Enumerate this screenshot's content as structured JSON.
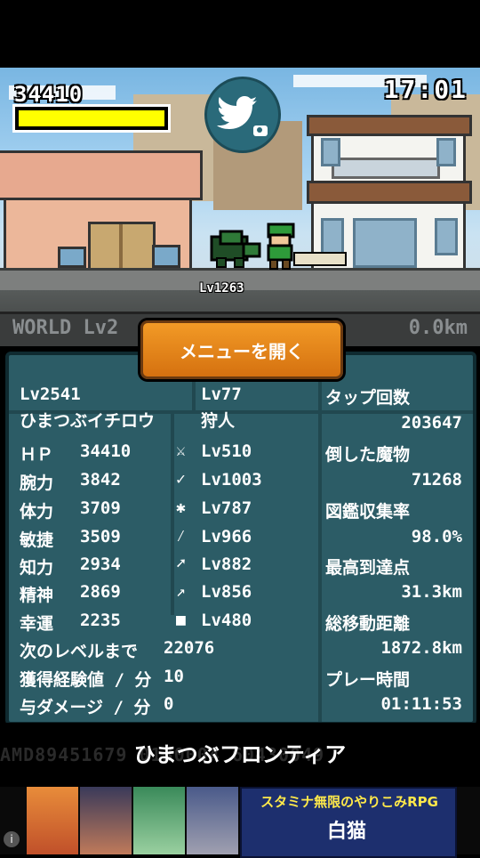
{
  "hud": {
    "score": "34410",
    "hp_fraction": 1.0,
    "clock": "17:01",
    "player_level_tag": "Lv1263",
    "world_label": "WORLD Lv2",
    "distance_label": "0.0km"
  },
  "menu": {
    "open_label": "メニューを開く"
  },
  "stats": {
    "player_level": "Lv2541",
    "player_name": "ひまつぶイチロウ",
    "job_level": "Lv77",
    "job_name": "狩人",
    "attributes": [
      {
        "label": "ＨＰ",
        "value": "34410",
        "skill_icon": "sword-icon",
        "skill": "Lv510"
      },
      {
        "label": "腕力",
        "value": "3842",
        "skill_icon": "dagger-icon",
        "skill": "Lv1003"
      },
      {
        "label": "体力",
        "value": "3709",
        "skill_icon": "axe-icon",
        "skill": "Lv787"
      },
      {
        "label": "敏捷",
        "value": "3509",
        "skill_icon": "spear-icon",
        "skill": "Lv966"
      },
      {
        "label": "知力",
        "value": "2934",
        "skill_icon": "bow-icon",
        "skill": "Lv882"
      },
      {
        "label": "精神",
        "value": "2869",
        "skill_icon": "staff-icon",
        "skill": "Lv856"
      },
      {
        "label": "幸運",
        "value": "2235",
        "skill_icon": "shield-icon",
        "skill": "Lv480"
      }
    ],
    "next_level_label": "次のレベルまで",
    "next_level_value": "22076",
    "exp_per_min_label": "獲得経験値 / 分",
    "exp_per_min_value": "10",
    "dmg_per_min_label": "与ダメージ / 分",
    "dmg_per_min_value": "0",
    "right": [
      {
        "label": "タップ回数",
        "value": "203647"
      },
      {
        "label": "倒した魔物",
        "value": "71268"
      },
      {
        "label": "図鑑収集率",
        "value": "98.0%"
      },
      {
        "label": "最高到達点",
        "value": "31.3km"
      },
      {
        "label": "総移動距離",
        "value": "1872.8km"
      },
      {
        "label": "プレー時間",
        "value": "01:11:53"
      }
    ]
  },
  "footer": {
    "bg_digits": "AMD89451679 0130004 60430049",
    "game_title": "ひまつぶフロンティア"
  },
  "ad": {
    "banner_text": "スタミナ無限のやりこみRPG",
    "banner_logo": "白猫",
    "info_icon": "info-icon"
  },
  "colors": {
    "panel": "#2c5c66",
    "hp_bar": "#ffff00",
    "menu_button": "#e8831a"
  }
}
